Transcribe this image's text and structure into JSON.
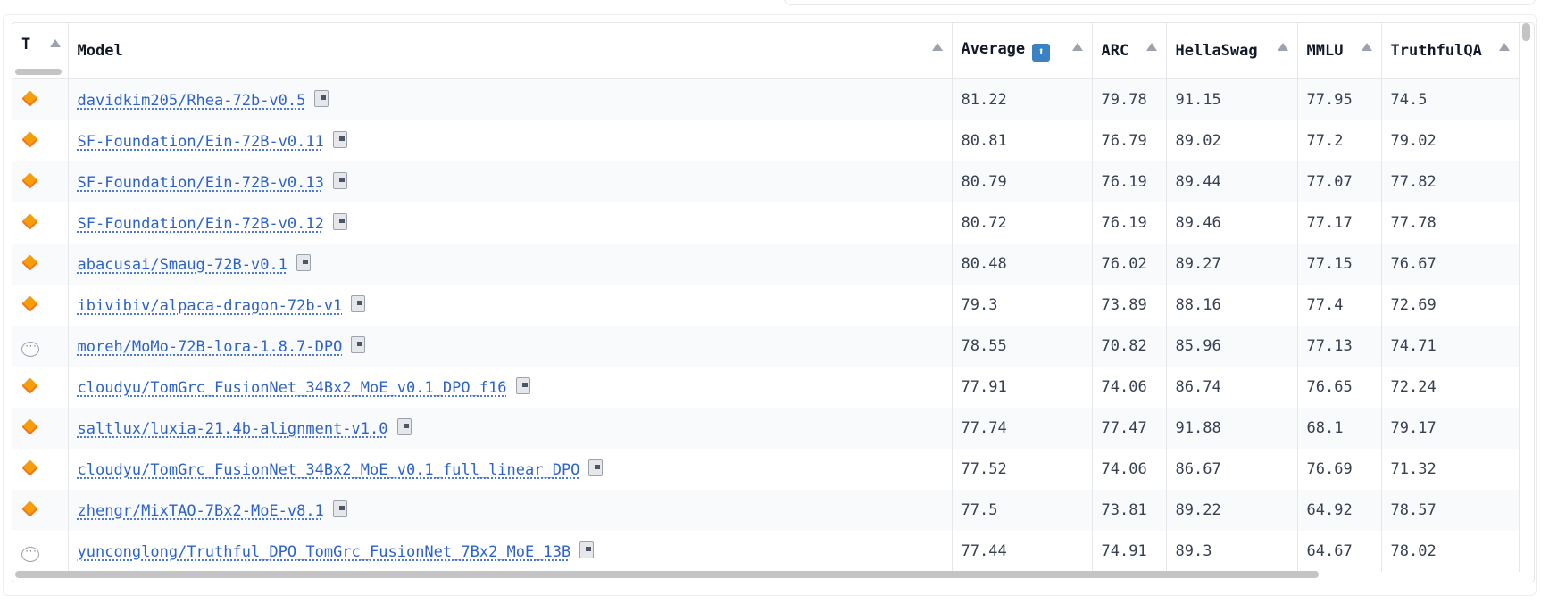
{
  "table": {
    "columns": [
      {
        "key": "type",
        "label": "T"
      },
      {
        "key": "model",
        "label": "Model"
      },
      {
        "key": "average",
        "label": "Average",
        "badge": "⬆"
      },
      {
        "key": "arc",
        "label": "ARC"
      },
      {
        "key": "hellaswag",
        "label": "HellaSwag"
      },
      {
        "key": "mmlu",
        "label": "MMLU"
      },
      {
        "key": "truthfulqa",
        "label": "TruthfulQA"
      }
    ],
    "rows": [
      {
        "type": "diamond",
        "model": "davidkim205/Rhea-72b-v0.5",
        "average": "81.22",
        "arc": "79.78",
        "hellaswag": "91.15",
        "mmlu": "77.95",
        "truthfulqa": "74.5"
      },
      {
        "type": "diamond",
        "model": "SF-Foundation/Ein-72B-v0.11",
        "average": "80.81",
        "arc": "76.79",
        "hellaswag": "89.02",
        "mmlu": "77.2",
        "truthfulqa": "79.02"
      },
      {
        "type": "diamond",
        "model": "SF-Foundation/Ein-72B-v0.13",
        "average": "80.79",
        "arc": "76.19",
        "hellaswag": "89.44",
        "mmlu": "77.07",
        "truthfulqa": "77.82"
      },
      {
        "type": "diamond",
        "model": "SF-Foundation/Ein-72B-v0.12",
        "average": "80.72",
        "arc": "76.19",
        "hellaswag": "89.46",
        "mmlu": "77.17",
        "truthfulqa": "77.78"
      },
      {
        "type": "diamond",
        "model": "abacusai/Smaug-72B-v0.1",
        "average": "80.48",
        "arc": "76.02",
        "hellaswag": "89.27",
        "mmlu": "77.15",
        "truthfulqa": "76.67"
      },
      {
        "type": "diamond",
        "model": "ibivibiv/alpaca-dragon-72b-v1",
        "average": "79.3",
        "arc": "73.89",
        "hellaswag": "88.16",
        "mmlu": "77.4",
        "truthfulqa": "72.69"
      },
      {
        "type": "chat",
        "model": "moreh/MoMo-72B-lora-1.8.7-DPO",
        "average": "78.55",
        "arc": "70.82",
        "hellaswag": "85.96",
        "mmlu": "77.13",
        "truthfulqa": "74.71"
      },
      {
        "type": "diamond",
        "model": "cloudyu/TomGrc_FusionNet_34Bx2_MoE_v0.1_DPO_f16",
        "average": "77.91",
        "arc": "74.06",
        "hellaswag": "86.74",
        "mmlu": "76.65",
        "truthfulqa": "72.24"
      },
      {
        "type": "diamond",
        "model": "saltlux/luxia-21.4b-alignment-v1.0",
        "average": "77.74",
        "arc": "77.47",
        "hellaswag": "91.88",
        "mmlu": "68.1",
        "truthfulqa": "79.17"
      },
      {
        "type": "diamond",
        "model": "cloudyu/TomGrc_FusionNet_34Bx2_MoE_v0.1_full_linear_DPO",
        "average": "77.52",
        "arc": "74.06",
        "hellaswag": "86.67",
        "mmlu": "76.69",
        "truthfulqa": "71.32"
      },
      {
        "type": "diamond",
        "model": "zhengr/MixTAO-7Bx2-MoE-v8.1",
        "average": "77.5",
        "arc": "73.81",
        "hellaswag": "89.22",
        "mmlu": "64.92",
        "truthfulqa": "78.57"
      },
      {
        "type": "chat",
        "model": "yunconglong/Truthful_DPO_TomGrc_FusionNet_7Bx2_MoE_13B",
        "average": "77.44",
        "arc": "74.91",
        "hellaswag": "89.3",
        "mmlu": "64.67",
        "truthfulqa": "78.02"
      }
    ]
  },
  "icons": {
    "diamond": "orange-diamond-icon",
    "chat": "chat-bubble-icon",
    "copy": "copy-icon"
  },
  "colors": {
    "link": "#2d63c8",
    "diamond": "#f59e0b",
    "stripe": "#f9fafb"
  }
}
